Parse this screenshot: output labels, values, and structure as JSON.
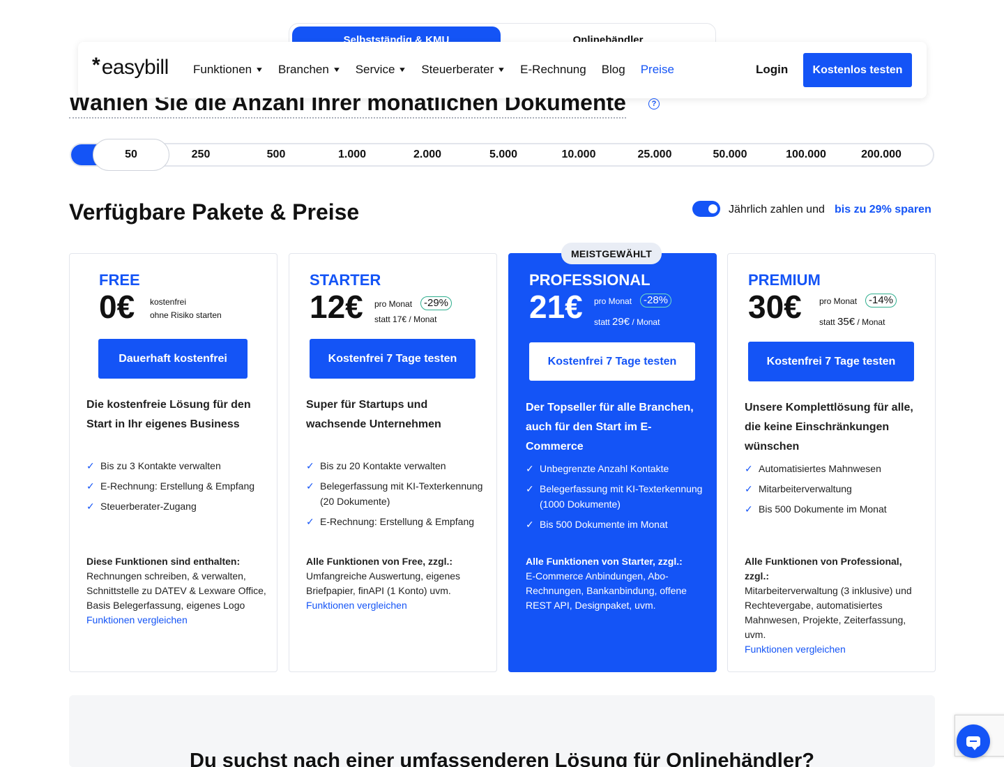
{
  "tabs": {
    "active": "Selbstständig & KMU",
    "inactive": "Onlinehändler"
  },
  "header": {
    "logo": "easybill",
    "nav": [
      "Funktionen",
      "Branchen",
      "Service",
      "Steuerberater",
      "E-Rechnung",
      "Blog",
      "Preise"
    ],
    "login": "Login",
    "cta": "Kostenlos testen"
  },
  "documents": {
    "heading": "Wählen Sie die Anzahl Ihrer monatlichen Dokumente",
    "help_icon": "question-circle-icon",
    "selected": "50",
    "options": [
      "50",
      "250",
      "500",
      "1.000",
      "2.000",
      "5.000",
      "10.000",
      "25.000",
      "50.000",
      "100.000",
      "200.000"
    ],
    "selected_index": 0
  },
  "packages": {
    "heading": "Verfügbare Pakete & Preise",
    "billing_toggle_on": true,
    "billing_label": "Jährlich zahlen und",
    "billing_save": "bis zu 29% sparen",
    "badge": "MEISTGEWÄHLT"
  },
  "plans": [
    {
      "name": "FREE",
      "price": "0€",
      "note1": "kostenfrei",
      "note2": "ohne Risiko starten",
      "button": "Dauerhaft kostenfrei",
      "description": "Die kostenfreie Lösung für den Start in Ihr eigenes Business",
      "features": [
        "Bis zu 3 Kontakte verwalten",
        "E-Rechnung: Erstellung & Empfang",
        "Steuerberater-Zugang"
      ],
      "included_title": "Diese Funktionen sind enthalten:",
      "included_text": "Rechnungen schreiben, & verwalten, Schnittstelle zu DATEV & Lexware Office, Basis Belegerfassung, eigenes Logo",
      "compare": "Funktionen vergleichen"
    },
    {
      "name": "STARTER",
      "price": "12€",
      "per": "pro Monat",
      "discount": "-29%",
      "was_prefix": "statt",
      "was_value": "17€",
      "was_suffix": "/ Monat",
      "button": "Kostenfrei 7 Tage testen",
      "description": "Super für Startups und wachsende Unternehmen",
      "features": [
        "Bis zu 20 Kontakte verwalten",
        "Belegerfassung mit KI-Texterkennung (20 Dokumente)",
        "E-Rechnung: Erstellung & Empfang"
      ],
      "included_title": "Alle Funktionen von Free, zzgl.:",
      "included_text": "Umfangreiche Auswertung, eigenes Briefpapier, finAPI (1 Konto) uvm.",
      "compare": "Funktionen vergleichen"
    },
    {
      "name": "PROFESSIONAL",
      "price": "21€",
      "per": "pro Monat",
      "discount": "-28%",
      "was_prefix": "statt",
      "was_value": "29€",
      "was_suffix": "/ Monat",
      "button": "Kostenfrei 7 Tage testen",
      "description": "Der Topseller für alle Branchen, auch für den Start im E-Commerce",
      "features": [
        "Unbegrenzte Anzahl Kontakte",
        "Belegerfassung mit KI-Texterkennung (1000 Dokumente)",
        "Bis 500 Dokumente im Monat"
      ],
      "included_title": "Alle Funktionen von Starter, zzgl.:",
      "included_text": "E-Commerce Anbindungen, Abo-Rechnungen, Bankanbindung, offene REST API, Designpaket, uvm."
    },
    {
      "name": "PREMIUM",
      "price": "30€",
      "per": "pro Monat",
      "discount": "-14%",
      "was_prefix": "statt",
      "was_value": "35€",
      "was_suffix": "/ Monat",
      "button": "Kostenfrei 7 Tage testen",
      "description": "Unsere Komplettlösung für alle, die keine Einschränkungen wünschen",
      "features": [
        "Automatisiertes Mahnwesen",
        "Mitarbeiterverwaltung",
        "Bis 500 Dokumente im Monat"
      ],
      "included_title": "Alle Funktionen von Professional, zzgl.:",
      "included_text": "Mitarbeiterverwaltung (3 inklusive) und Rechtevergabe, automatisiertes Mahnwesen, Projekte, Zeiterfassung, uvm.",
      "compare": "Funktionen vergleichen"
    }
  ],
  "bottom": {
    "heading": "Du suchst nach einer umfassenderen Lösung für Onlinehändler?"
  },
  "colors": {
    "accent": "#1454f6",
    "discount_border": "#2fae8e"
  }
}
